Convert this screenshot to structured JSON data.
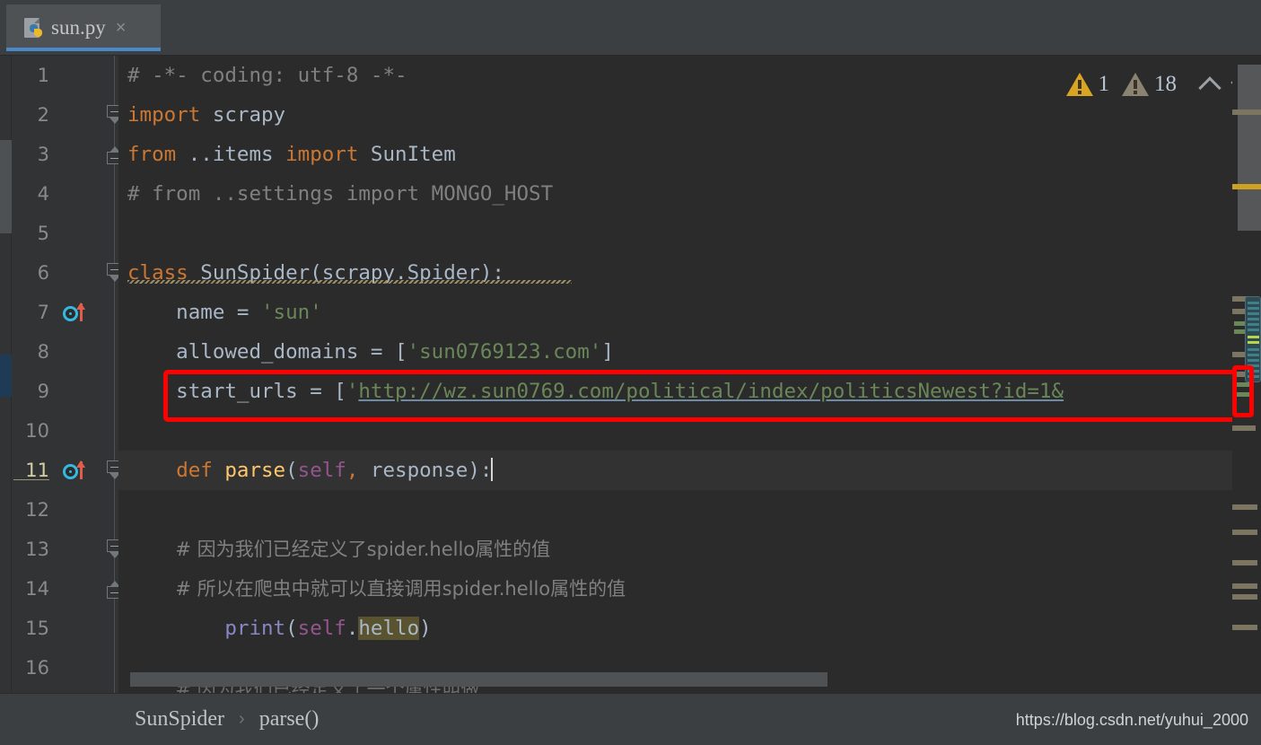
{
  "window": {
    "theme_background": "#2b2b2b",
    "accent_color": "#4a88c7",
    "annotation_color": "#fe0000"
  },
  "tab": {
    "filename": "sun.py",
    "close_label": "×",
    "icon": "python-file-icon"
  },
  "inspection_widget": {
    "warning_count": "1",
    "weak_warning_count": "18",
    "prev_label": "⌃",
    "next_label": "⌄"
  },
  "editor": {
    "current_line": 11,
    "gutter_line_numbers": [
      "1",
      "2",
      "3",
      "4",
      "5",
      "6",
      "7",
      "8",
      "9",
      "10",
      "11",
      "12",
      "13",
      "14",
      "15",
      "16"
    ],
    "run_markers_on_lines": [
      7,
      11
    ],
    "lines": [
      {
        "n": 1,
        "segments": [
          {
            "t": "# -*- coding: utf-8 -*-",
            "c": "cmt"
          }
        ]
      },
      {
        "n": 2,
        "segments": [
          {
            "t": "import",
            "c": "kw"
          },
          {
            "t": " scrapy",
            "c": "ident"
          }
        ]
      },
      {
        "n": 3,
        "segments": [
          {
            "t": "from",
            "c": "kw"
          },
          {
            "t": " ..items ",
            "c": "ident"
          },
          {
            "t": "import",
            "c": "kw"
          },
          {
            "t": " SunItem",
            "c": "ident"
          }
        ]
      },
      {
        "n": 4,
        "segments": [
          {
            "t": "# from ..settings import MONGO_HOST",
            "c": "cmt"
          }
        ]
      },
      {
        "n": 5,
        "segments": []
      },
      {
        "n": 6,
        "segments": [
          {
            "t": "class",
            "c": "kw"
          },
          {
            "t": " SunSpider(scrapy.Spider):",
            "c": "ident"
          }
        ]
      },
      {
        "n": 7,
        "segments": [
          {
            "t": "    name = ",
            "c": "ident"
          },
          {
            "t": "'sun'",
            "c": "str"
          }
        ]
      },
      {
        "n": 8,
        "segments": [
          {
            "t": "    allowed_domains = [",
            "c": "ident"
          },
          {
            "t": "'sun0769123.com'",
            "c": "str"
          },
          {
            "t": "]",
            "c": "punc"
          }
        ]
      },
      {
        "n": 9,
        "segments": [
          {
            "t": "    start_urls = [",
            "c": "ident"
          },
          {
            "t": "'",
            "c": "str"
          },
          {
            "t": "http://wz.sun0769.com/political/index/politicsNewest?id=1&",
            "c": "url"
          }
        ]
      },
      {
        "n": 10,
        "segments": []
      },
      {
        "n": 11,
        "segments": [
          {
            "t": "    ",
            "c": "ident"
          },
          {
            "t": "def",
            "c": "kw"
          },
          {
            "t": " ",
            "c": "ident"
          },
          {
            "t": "parse",
            "c": "fn"
          },
          {
            "t": "(",
            "c": "punc"
          },
          {
            "t": "self",
            "c": "self"
          },
          {
            "t": ",",
            "c": "comma"
          },
          {
            "t": " response",
            "c": "ident"
          },
          {
            "t": "):",
            "c": "punc"
          }
        ]
      },
      {
        "n": 12,
        "segments": []
      },
      {
        "n": 13,
        "segments": [
          {
            "t": "        # 因为我们已经定义了spider.hello属性的值",
            "c": "cmt"
          }
        ]
      },
      {
        "n": 14,
        "segments": [
          {
            "t": "        # 所以在爬虫中就可以直接调用spider.hello属性的值",
            "c": "cmt"
          }
        ]
      },
      {
        "n": 15,
        "segments": [
          {
            "t": "        ",
            "c": "ident"
          },
          {
            "t": "print",
            "c": "builtin"
          },
          {
            "t": "(",
            "c": "punc"
          },
          {
            "t": "self",
            "c": "self"
          },
          {
            "t": ".",
            "c": "punc"
          },
          {
            "t": "hello",
            "c": "hl"
          },
          {
            "t": ")",
            "c": "punc"
          }
        ]
      },
      {
        "n": 16,
        "segments": []
      }
    ],
    "partial_next_line": "        # 因为我们已经定义了一个属性叫做"
  },
  "breadcrumb": {
    "class_name": "SunSpider",
    "separator": "›",
    "method_name": "parse()"
  },
  "watermark": {
    "text": "https://blog.csdn.net/yuhui_2000"
  }
}
